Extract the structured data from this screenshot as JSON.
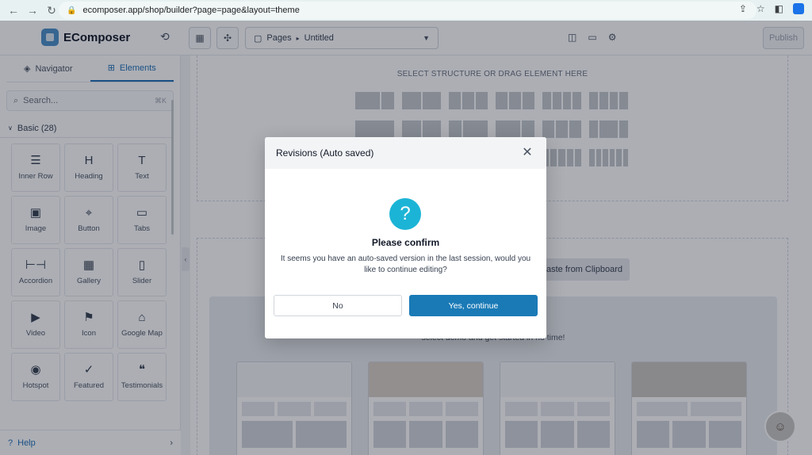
{
  "browser": {
    "url": "ecomposer.app/shop/builder?page=page&layout=theme"
  },
  "topbar": {
    "app_name": "EComposer",
    "pages_label": "Pages",
    "breadcrumb_sep": "▸",
    "current_page": "Untitled",
    "publish_label": "Publish"
  },
  "sidebar": {
    "tabs": [
      {
        "label": "Navigator"
      },
      {
        "label": "Elements"
      }
    ],
    "search_placeholder": "Search...",
    "search_shortcut": "⌘K",
    "section_label": "Basic (28)",
    "elements": [
      {
        "label": "Inner Row",
        "icon": "☰"
      },
      {
        "label": "Heading",
        "icon": "H"
      },
      {
        "label": "Text",
        "icon": "T"
      },
      {
        "label": "Image",
        "icon": "▣"
      },
      {
        "label": "Button",
        "icon": "⌖"
      },
      {
        "label": "Tabs",
        "icon": "▭"
      },
      {
        "label": "Accordion",
        "icon": "⊢⊣"
      },
      {
        "label": "Gallery",
        "icon": "▦"
      },
      {
        "label": "Slider",
        "icon": "▯"
      },
      {
        "label": "Video",
        "icon": "▶"
      },
      {
        "label": "Icon",
        "icon": "⚑"
      },
      {
        "label": "Google Map",
        "icon": "⌂"
      },
      {
        "label": "Hotspot",
        "icon": "◉"
      },
      {
        "label": "Featured",
        "icon": "✓"
      },
      {
        "label": "Testimonials",
        "icon": "❝"
      }
    ],
    "help_label": "Help"
  },
  "canvas": {
    "select_structure_title": "SELECT STRUCTURE OR DRAG ELEMENT HERE",
    "paste_label": "aste from Clipboard",
    "templates_caption": "select demo and get started in no time!"
  },
  "modal": {
    "title": "Revisions (Auto saved)",
    "confirm_title": "Please confirm",
    "message": "It seems you have an auto-saved version in the last session, would you like to continue editing?",
    "no_label": "No",
    "yes_label": "Yes, continue"
  },
  "colors": {
    "accent": "#1a7ab6",
    "question_icon": "#1cb4d6",
    "active_tab": "#1f6fb5"
  }
}
